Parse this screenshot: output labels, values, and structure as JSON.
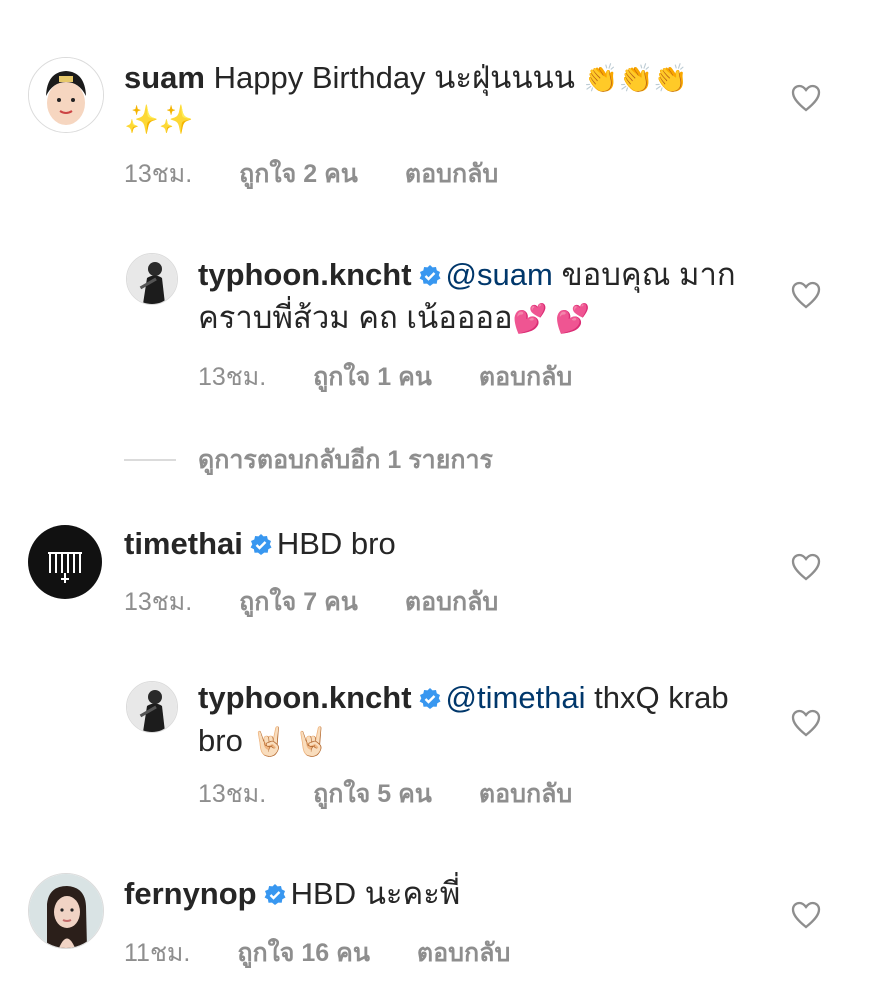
{
  "comments": [
    {
      "username": "suam",
      "text": "Happy Birthday นะฝุ่นนนน",
      "emojis": "👏👏👏 ✨✨",
      "time": "13ชม.",
      "likes": "ถูกใจ 2 คน",
      "reply": "ตอบกลับ",
      "verified": false
    },
    {
      "username": "typhoon.kncht",
      "mention": "@suam",
      "text": " ขอบคุณ มากคราบพี่ส้วม คถ เน้ออออ",
      "emojis": "💕 💕",
      "time": "13ชม.",
      "likes": "ถูกใจ 1 คน",
      "reply": "ตอบกลับ",
      "verified": true
    },
    {
      "username": "timethai",
      "text": "HBD bro",
      "time": "13ชม.",
      "likes": "ถูกใจ 7 คน",
      "reply": "ตอบกลับ",
      "verified": true
    },
    {
      "username": "typhoon.kncht",
      "mention": "@timethai",
      "text": " thxQ krab bro",
      "emojis": "🤘🏻 🤘🏻",
      "time": "13ชม.",
      "likes": "ถูกใจ 5 คน",
      "reply": "ตอบกลับ",
      "verified": true
    },
    {
      "username": "fernynop",
      "text": "HBD นะคะพี่",
      "time": "11ชม.",
      "likes": "ถูกใจ 16 คน",
      "reply": "ตอบกลับ",
      "verified": true
    }
  ],
  "view_more_replies": "ดูการตอบกลับอีก 1 รายการ",
  "colors": {
    "verified": "#3897f0",
    "meta": "#8e8e8e",
    "mention": "#00376b"
  },
  "icons": {
    "like": "heart-outline-icon",
    "verified": "verified-badge-icon"
  }
}
